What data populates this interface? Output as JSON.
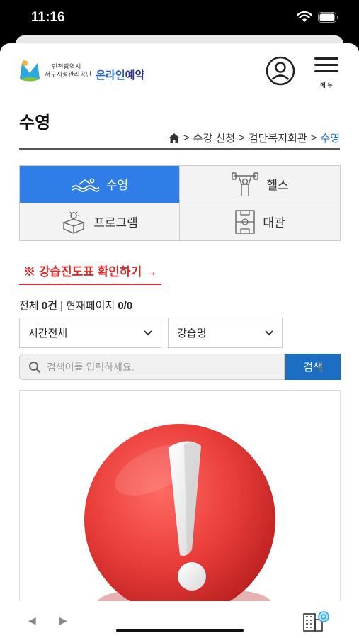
{
  "status_bar": {
    "time": "11:16"
  },
  "header": {
    "org_line1": "인천광역시",
    "org_line2": "서구시설관리공단",
    "brand_part1": "온라인",
    "brand_part2": "예약",
    "menu_label": "메 뉴"
  },
  "page": {
    "title": "수영",
    "breadcrumb": [
      "수강 신청",
      "검단복지회관",
      "수영"
    ]
  },
  "tabs": [
    {
      "label": "수영",
      "icon": "swim-icon",
      "active": true
    },
    {
      "label": "헬스",
      "icon": "weightlifting-icon",
      "active": false
    },
    {
      "label": "프로그램",
      "icon": "program-box-icon",
      "active": false
    },
    {
      "label": "대관",
      "icon": "court-icon",
      "active": false
    }
  ],
  "progress_link": "※ 강습진도표 확인하기 →",
  "counts": {
    "prefix": "전체 ",
    "total": "0건",
    "separator": " | 현재페이지 ",
    "page": "0/0"
  },
  "filters": {
    "time_select": "시간전체",
    "lesson_select": "강습명"
  },
  "search": {
    "placeholder": "검색어를 입력하세요.",
    "button": "검색"
  },
  "colors": {
    "accent": "#2f7ee8",
    "search_button": "#1b6ec2",
    "link_red": "#d92b2b",
    "alert_red": "#e8423f"
  }
}
